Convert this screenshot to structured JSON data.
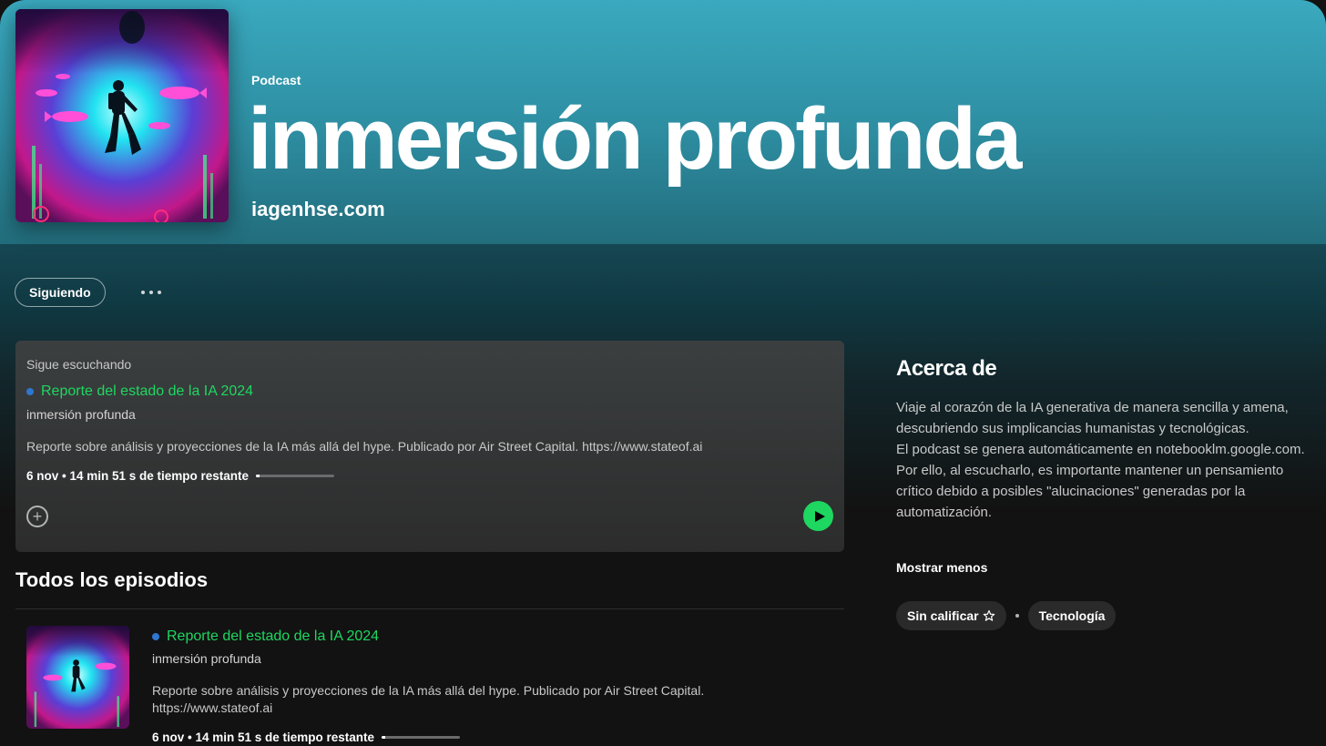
{
  "header": {
    "type_label": "Podcast",
    "title": "inmersión profunda",
    "publisher": "iagenhse.com"
  },
  "actions": {
    "follow_label": "Siguiendo",
    "more_icon": "more-horizontal-icon"
  },
  "continue_listening": {
    "section_label": "Sigue escuchando",
    "episode": {
      "title": "Reporte del estado de la IA 2024",
      "show": "inmersión profunda",
      "description": "Reporte sobre análisis y proyecciones de la IA más allá del hype. Publicado por Air Street Capital. https://www.stateof.ai",
      "meta": "6 nov • 14 min 51 s de tiempo restante",
      "progress_fraction": 0.05
    },
    "add_icon": "add-circle-icon",
    "play_icon": "play-icon"
  },
  "episodes": {
    "heading": "Todos los episodios",
    "items": [
      {
        "title": "Reporte del estado de la IA 2024",
        "show": "inmersión profunda",
        "description": "Reporte sobre análisis y proyecciones de la IA más allá del hype. Publicado por Air Street Capital. https://www.stateof.ai",
        "meta": "6 nov • 14 min 51 s de tiempo restante",
        "progress_fraction": 0.05
      }
    ]
  },
  "about": {
    "heading": "Acerca de",
    "paragraph_1": "Viaje al corazón de la IA generativa de manera sencilla y amena, descubriendo sus implicancias humanistas y tecnológicas.",
    "paragraph_2": "El podcast se genera automáticamente en notebooklm.google.com. Por ello, al escucharlo, es importante mantener un pensamiento crítico debido a posibles \"alucinaciones\" generadas por la automatización.",
    "show_less_label": "Mostrar menos",
    "rating_label": "Sin calificar",
    "rating_icon": "star-outline-icon",
    "category_label": "Tecnología"
  },
  "colors": {
    "accent_green": "#1ed760",
    "header_teal": "#3aa9bf",
    "unplayed_dot": "#2e77d0",
    "background": "#121212"
  }
}
